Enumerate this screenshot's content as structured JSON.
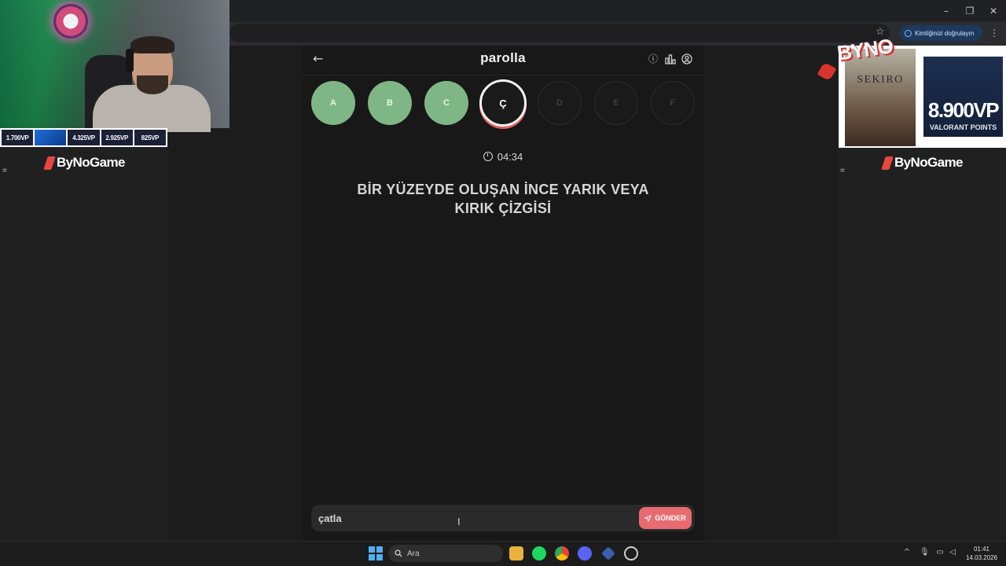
{
  "browser": {
    "verify_label": "Kimliğinizi doğrulayın",
    "win_minimize": "–",
    "win_restore": "❐",
    "win_close": "✕",
    "star": "☆",
    "menu": "⋮"
  },
  "game": {
    "title": "parolla",
    "back_icon": "←",
    "letters": [
      {
        "label": "A",
        "state": "done"
      },
      {
        "label": "B",
        "state": "done"
      },
      {
        "label": "C",
        "state": "done"
      },
      {
        "label": "Ç",
        "state": "active"
      },
      {
        "label": "D",
        "state": "pending"
      },
      {
        "label": "E",
        "state": "pending"
      },
      {
        "label": "F",
        "state": "pending"
      }
    ],
    "timer": "04:34",
    "question": "BİR YÜZEYDE OLUŞAN İNCE YARIK VEYA KIRIK ÇİZGİSİ",
    "answer_value": "çatla",
    "send_label": "GÖNDER"
  },
  "overlay": {
    "vp_tiles": [
      "1.700VP",
      "",
      "4.325VP",
      "2.925VP",
      "825VP"
    ],
    "brand": "ByNoGame",
    "byno_tag": "BYNO",
    "sekiro_title": "SEKIRO",
    "valorant_amount": "8.900VP",
    "valorant_sub": "VALORANT POINTS",
    "menu_glyph": "="
  },
  "taskbar": {
    "search_label": "Ara",
    "time": "01:41",
    "date": "14.03.2026"
  },
  "colors": {
    "done_circle": "#7fb685",
    "send_button": "#e86b72",
    "active_ring": "#f2f2f2"
  }
}
